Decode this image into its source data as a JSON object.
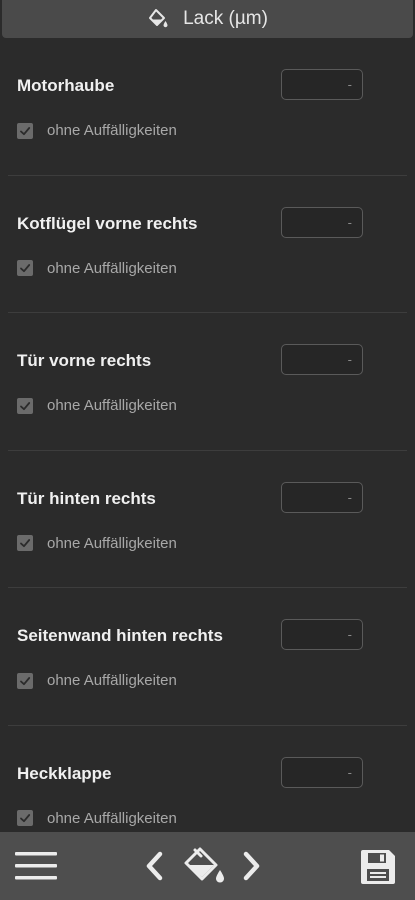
{
  "header": {
    "title": "Lack (µm)",
    "icon": "paint-bucket-icon"
  },
  "sections": [
    {
      "title": "Motorhaube",
      "value": "-",
      "checkbox_label": "ohne Auffälligkeiten",
      "checked": true
    },
    {
      "title": "Kotflügel vorne rechts",
      "value": "-",
      "checkbox_label": "ohne Auffälligkeiten",
      "checked": true
    },
    {
      "title": "Tür vorne rechts",
      "value": "-",
      "checkbox_label": "ohne Auffälligkeiten",
      "checked": true
    },
    {
      "title": "Tür hinten rechts",
      "value": "-",
      "checkbox_label": "ohne Auffälligkeiten",
      "checked": true
    },
    {
      "title": "Seitenwand hinten rechts",
      "value": "-",
      "checkbox_label": "ohne Auffälligkeiten",
      "checked": true
    },
    {
      "title": "Heckklappe",
      "value": "-",
      "checkbox_label": "ohne Auffälligkeiten",
      "checked": true
    }
  ],
  "bottom_bar": {
    "menu_icon": "hamburger-menu-icon",
    "prev_icon": "chevron-left-icon",
    "paint_icon": "paint-bucket-icon",
    "next_icon": "chevron-right-icon",
    "save_icon": "floppy-disk-icon"
  },
  "colors": {
    "background": "#2b2b2b",
    "header": "#4a4a4a",
    "bottom_bar": "#4e4e4e",
    "text": "#f0f0f0",
    "muted_text": "#a8a8a8",
    "checkbox": "#6b6b6b"
  }
}
